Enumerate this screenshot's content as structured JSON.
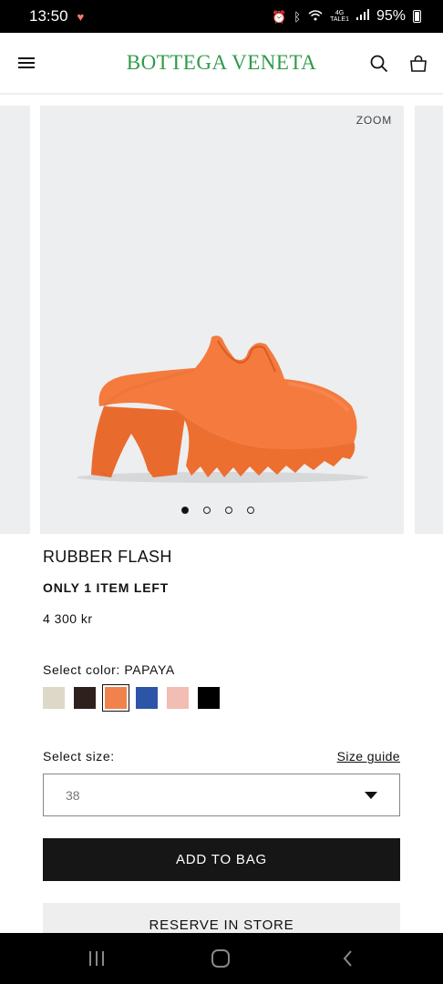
{
  "status_bar": {
    "time": "13:50",
    "network_top": "4G",
    "network_bottom": "TALE1",
    "battery": "95%"
  },
  "header": {
    "brand": "BOTTEGA VENETA",
    "brand_color": "#2f9a4a"
  },
  "gallery": {
    "zoom_label": "ZOOM",
    "dots_count": 4,
    "active_dot": 0,
    "product_color": "#f47a3e"
  },
  "product": {
    "title": "RUBBER FLASH",
    "stock": "ONLY 1 ITEM LEFT",
    "price": "4 300 kr"
  },
  "color_select": {
    "label": "Select color: PAPAYA",
    "swatches": [
      {
        "name": "beige",
        "hex": "#ddd8c8"
      },
      {
        "name": "dark-brown",
        "hex": "#2e211d"
      },
      {
        "name": "papaya",
        "hex": "#f0834d",
        "selected": true
      },
      {
        "name": "blue",
        "hex": "#2c55a8"
      },
      {
        "name": "pink",
        "hex": "#f2bdb3"
      },
      {
        "name": "black",
        "hex": "#000000"
      }
    ]
  },
  "size_select": {
    "label": "Select size:",
    "guide_link": "Size guide",
    "value": "38"
  },
  "actions": {
    "add_to_bag": "ADD TO BAG",
    "reserve": "RESERVE IN STORE"
  }
}
